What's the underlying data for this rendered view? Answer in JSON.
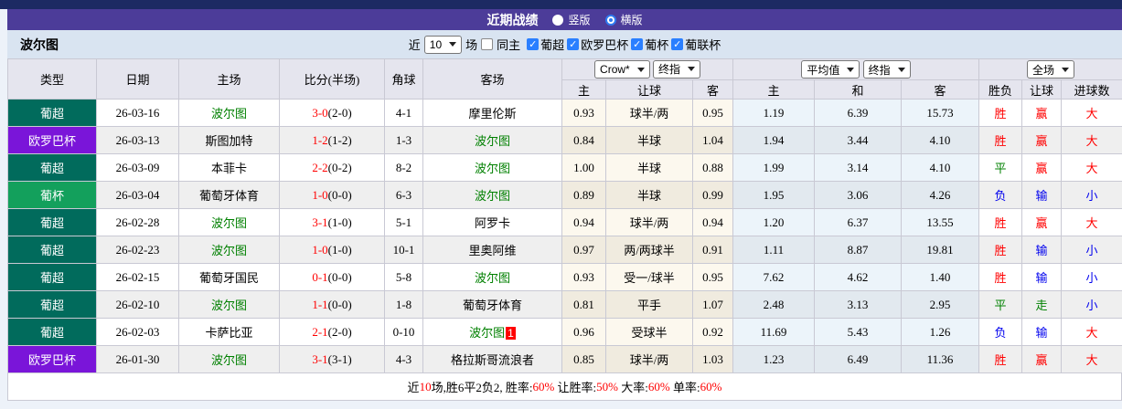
{
  "title_bar": {
    "title": "近期战绩",
    "view_options": [
      {
        "label": "竖版",
        "selected": false
      },
      {
        "label": "横版",
        "selected": true
      }
    ]
  },
  "filter_bar": {
    "team": "波尔图",
    "prefix": "近",
    "count": "10",
    "suffix": "场",
    "same_home": {
      "label": "同主",
      "checked": false
    },
    "leagues": [
      {
        "label": "葡超",
        "checked": true
      },
      {
        "label": "欧罗巴杯",
        "checked": true
      },
      {
        "label": "葡杯",
        "checked": true
      },
      {
        "label": "葡联杯",
        "checked": true
      }
    ]
  },
  "table": {
    "dropdowns": {
      "bookmaker": "Crow*",
      "handicap_stage": "终指",
      "europe_avg": "平均值",
      "europe_stage": "终指",
      "scope": "全场"
    },
    "header_main": [
      "类型",
      "日期",
      "主场",
      "比分(半场)",
      "角球",
      "客场"
    ],
    "header_sub": [
      "主",
      "让球",
      "客",
      "主",
      "和",
      "客",
      "胜负",
      "让球",
      "进球数"
    ],
    "league_colors": {
      "葡超": "#016b5c",
      "欧罗巴杯": "#7a15d9",
      "葡杯": "#13a05c"
    },
    "tone_colors": {
      "red": "#ff0000",
      "green": "#008000",
      "blue": "#0000ee"
    },
    "focus_team_color": "#008000",
    "rows": [
      {
        "league": "葡超",
        "date": "26-03-16",
        "home": "波尔图",
        "home_focus": true,
        "score": "3-0",
        "half": "(2-0)",
        "corner": "4-1",
        "away": "摩里伦斯",
        "away_focus": false,
        "away_badge": "",
        "ah_home": "0.93",
        "ah_line": "球半/两",
        "ah_away": "0.95",
        "eu_home": "1.19",
        "eu_draw": "6.39",
        "eu_away": "15.73",
        "wdl": "胜",
        "wdl_tone": "red",
        "handicap": "赢",
        "handicap_tone": "red",
        "goals": "大",
        "goals_tone": "red"
      },
      {
        "league": "欧罗巴杯",
        "date": "26-03-13",
        "home": "斯图加特",
        "home_focus": false,
        "score": "1-2",
        "half": "(1-2)",
        "corner": "1-3",
        "away": "波尔图",
        "away_focus": true,
        "away_badge": "",
        "ah_home": "0.84",
        "ah_line": "半球",
        "ah_away": "1.04",
        "eu_home": "1.94",
        "eu_draw": "3.44",
        "eu_away": "4.10",
        "wdl": "胜",
        "wdl_tone": "red",
        "handicap": "赢",
        "handicap_tone": "red",
        "goals": "大",
        "goals_tone": "red"
      },
      {
        "league": "葡超",
        "date": "26-03-09",
        "home": "本菲卡",
        "home_focus": false,
        "score": "2-2",
        "half": "(0-2)",
        "corner": "8-2",
        "away": "波尔图",
        "away_focus": true,
        "away_badge": "",
        "ah_home": "1.00",
        "ah_line": "半球",
        "ah_away": "0.88",
        "eu_home": "1.99",
        "eu_draw": "3.14",
        "eu_away": "4.10",
        "wdl": "平",
        "wdl_tone": "green",
        "handicap": "赢",
        "handicap_tone": "red",
        "goals": "大",
        "goals_tone": "red"
      },
      {
        "league": "葡杯",
        "date": "26-03-04",
        "home": "葡萄牙体育",
        "home_focus": false,
        "score": "1-0",
        "half": "(0-0)",
        "corner": "6-3",
        "away": "波尔图",
        "away_focus": true,
        "away_badge": "",
        "ah_home": "0.89",
        "ah_line": "半球",
        "ah_away": "0.99",
        "eu_home": "1.95",
        "eu_draw": "3.06",
        "eu_away": "4.26",
        "wdl": "负",
        "wdl_tone": "blue",
        "handicap": "输",
        "handicap_tone": "blue",
        "goals": "小",
        "goals_tone": "blue"
      },
      {
        "league": "葡超",
        "date": "26-02-28",
        "home": "波尔图",
        "home_focus": true,
        "score": "3-1",
        "half": "(1-0)",
        "corner": "5-1",
        "away": "阿罗卡",
        "away_focus": false,
        "away_badge": "",
        "ah_home": "0.94",
        "ah_line": "球半/两",
        "ah_away": "0.94",
        "eu_home": "1.20",
        "eu_draw": "6.37",
        "eu_away": "13.55",
        "wdl": "胜",
        "wdl_tone": "red",
        "handicap": "赢",
        "handicap_tone": "red",
        "goals": "大",
        "goals_tone": "red"
      },
      {
        "league": "葡超",
        "date": "26-02-23",
        "home": "波尔图",
        "home_focus": true,
        "score": "1-0",
        "half": "(1-0)",
        "corner": "10-1",
        "away": "里奥阿维",
        "away_focus": false,
        "away_badge": "",
        "ah_home": "0.97",
        "ah_line": "两/两球半",
        "ah_away": "0.91",
        "eu_home": "1.11",
        "eu_draw": "8.87",
        "eu_away": "19.81",
        "wdl": "胜",
        "wdl_tone": "red",
        "handicap": "输",
        "handicap_tone": "blue",
        "goals": "小",
        "goals_tone": "blue"
      },
      {
        "league": "葡超",
        "date": "26-02-15",
        "home": "葡萄牙国民",
        "home_focus": false,
        "score": "0-1",
        "half": "(0-0)",
        "corner": "5-8",
        "away": "波尔图",
        "away_focus": true,
        "away_badge": "",
        "ah_home": "0.93",
        "ah_line": "受一/球半",
        "ah_away": "0.95",
        "eu_home": "7.62",
        "eu_draw": "4.62",
        "eu_away": "1.40",
        "wdl": "胜",
        "wdl_tone": "red",
        "handicap": "输",
        "handicap_tone": "blue",
        "goals": "小",
        "goals_tone": "blue"
      },
      {
        "league": "葡超",
        "date": "26-02-10",
        "home": "波尔图",
        "home_focus": true,
        "score": "1-1",
        "half": "(0-0)",
        "corner": "1-8",
        "away": "葡萄牙体育",
        "away_focus": false,
        "away_badge": "",
        "ah_home": "0.81",
        "ah_line": "平手",
        "ah_away": "1.07",
        "eu_home": "2.48",
        "eu_draw": "3.13",
        "eu_away": "2.95",
        "wdl": "平",
        "wdl_tone": "green",
        "handicap": "走",
        "handicap_tone": "green",
        "goals": "小",
        "goals_tone": "blue"
      },
      {
        "league": "葡超",
        "date": "26-02-03",
        "home": "卡萨比亚",
        "home_focus": false,
        "score": "2-1",
        "half": "(2-0)",
        "corner": "0-10",
        "away": "波尔图",
        "away_focus": true,
        "away_badge": "1",
        "ah_home": "0.96",
        "ah_line": "受球半",
        "ah_away": "0.92",
        "eu_home": "11.69",
        "eu_draw": "5.43",
        "eu_away": "1.26",
        "wdl": "负",
        "wdl_tone": "blue",
        "handicap": "输",
        "handicap_tone": "blue",
        "goals": "大",
        "goals_tone": "red"
      },
      {
        "league": "欧罗巴杯",
        "date": "26-01-30",
        "home": "波尔图",
        "home_focus": true,
        "score": "3-1",
        "half": "(3-1)",
        "corner": "4-3",
        "away": "格拉斯哥流浪者",
        "away_focus": false,
        "away_badge": "",
        "ah_home": "0.85",
        "ah_line": "球半/两",
        "ah_away": "1.03",
        "eu_home": "1.23",
        "eu_draw": "6.49",
        "eu_away": "11.36",
        "wdl": "胜",
        "wdl_tone": "red",
        "handicap": "赢",
        "handicap_tone": "red",
        "goals": "大",
        "goals_tone": "red"
      }
    ]
  },
  "summary": {
    "segments": [
      {
        "text": "近",
        "red": false
      },
      {
        "text": "10",
        "red": true
      },
      {
        "text": "场,胜6平2负2, 胜率:",
        "red": false
      },
      {
        "text": "60%",
        "red": true
      },
      {
        "text": " 让胜率:",
        "red": false
      },
      {
        "text": "50%",
        "red": true
      },
      {
        "text": " 大率:",
        "red": false
      },
      {
        "text": "60%",
        "red": true
      },
      {
        "text": " 单率:",
        "red": false
      },
      {
        "text": "60%",
        "red": true
      }
    ]
  }
}
